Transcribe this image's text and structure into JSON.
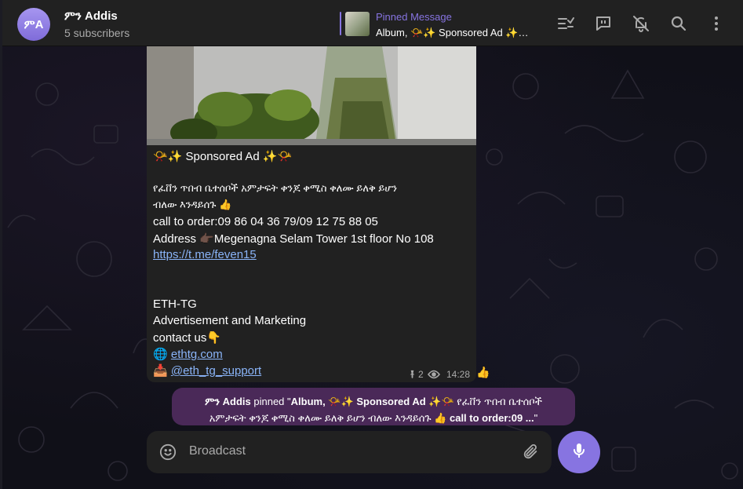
{
  "header": {
    "avatar_initials": "ምA",
    "channel_name": "ምን Addis",
    "subscribers": "5 subscribers",
    "pinned_title": "Pinned Message",
    "pinned_text": "Album, 📯✨ Sponsored Ad ✨…",
    "icons": [
      "topics-icon",
      "live-chat-icon",
      "mute-icon",
      "search-icon",
      "more-vertical-icon"
    ]
  },
  "message": {
    "line_ad_title": "📯✨ Sponsored Ad ✨📯",
    "line_amharic_1": "የፈቨን ጥበብ ቤተሰቦች አምታፍት ቀንጆ ቀሚስ ቀለሙ ይለቅ ይሆን",
    "line_amharic_2": "ብለው እንዳይሰጉ 👍",
    "line_call": "call to order:09 86 04 36 79/09 12 75 88 05",
    "line_address": "Address 👉🏿Megenagna Selam Tower 1st floor No 108",
    "line_link": "https://t.me/feven15",
    "line_ethtg": "ETH-TG",
    "line_adv": "Advertisement and Marketing",
    "line_contact": "contact us👇",
    "line_site_icon": "🌐",
    "line_site": "ethtg.com",
    "line_support_icon": "📥",
    "line_support": "@eth_tg_support",
    "pin_count": "2",
    "time": "14:28",
    "reaction": "👍"
  },
  "service": {
    "actor": "ምን Addis",
    "action": " pinned \"",
    "album": "Album,",
    "middle_1": " 📯✨ ",
    "sponsored": "Sponsored Ad",
    "middle_2": " ✨📯 የፈቨን ጥበብ ቤተሰቦች",
    "line2_amharic": "አምታፍት ቀንጆ ቀሚስ ቀለሙ ይለቅ ይሆን ብለው እንዳይሰጉ 👍 ",
    "line2_call": "call to order:09 ...",
    "close_quote": "\""
  },
  "composer": {
    "placeholder": "Broadcast"
  },
  "colors": {
    "accent": "#8774e1",
    "header_bg": "#212121",
    "bubble_bg": "#212121",
    "service_bg": "#4a2958",
    "link": "#8ab4f8"
  }
}
